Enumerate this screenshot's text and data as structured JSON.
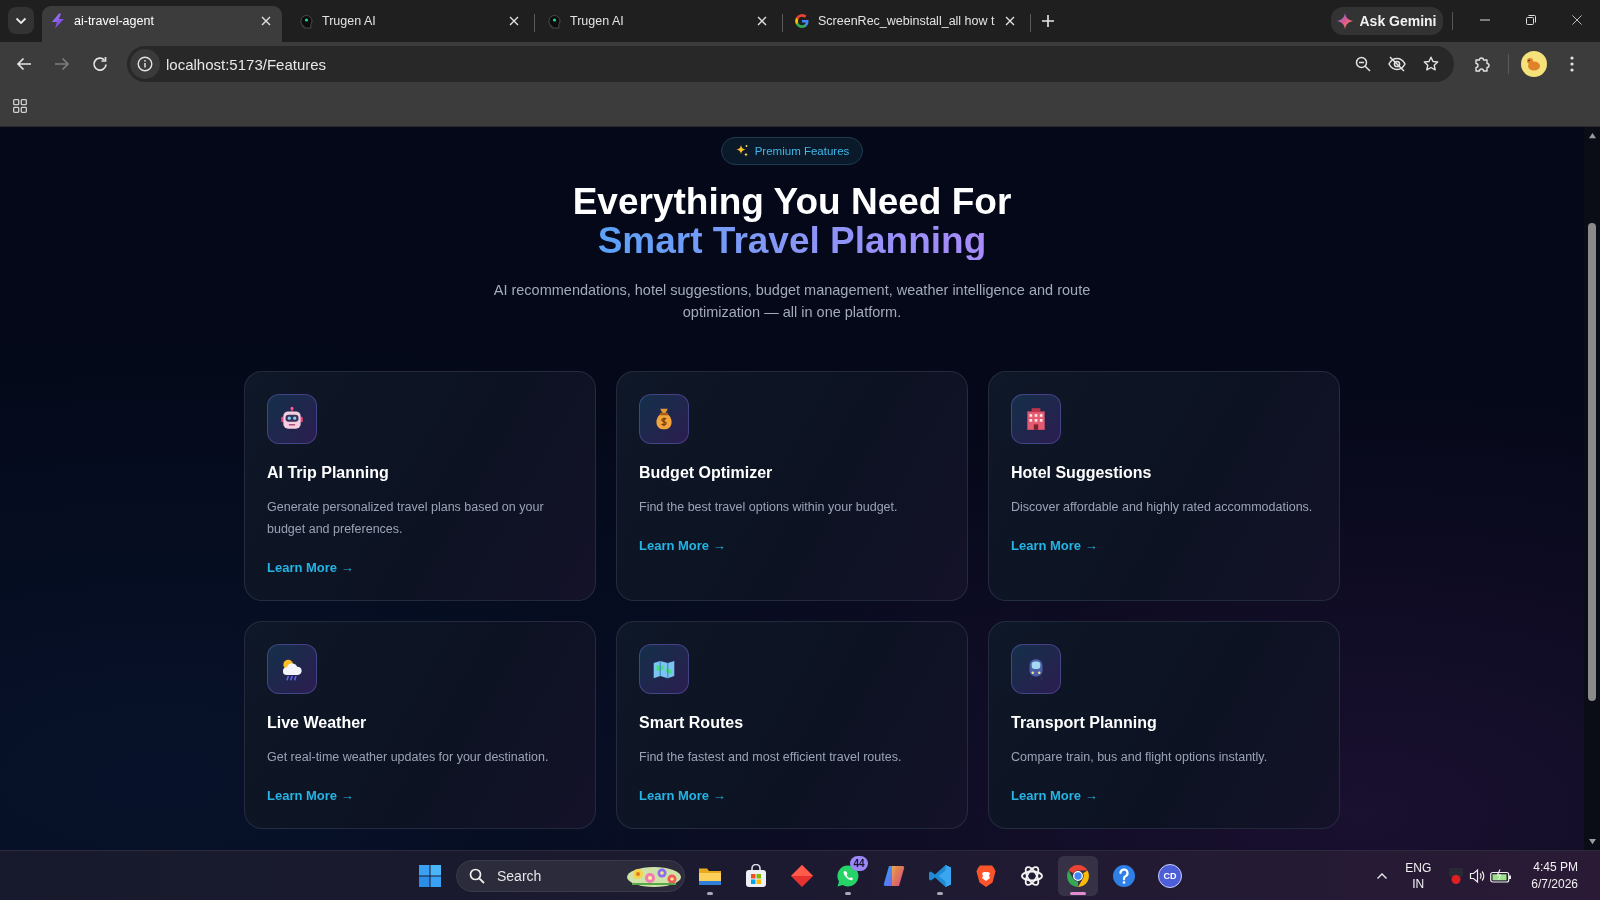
{
  "tabs": [
    {
      "kind": "bolt",
      "title": "ai-travel-agent",
      "selected": true
    },
    {
      "kind": "head",
      "title": "Trugen AI",
      "selected": false
    },
    {
      "kind": "head",
      "title": "Trugen AI",
      "selected": false
    },
    {
      "kind": "g-logo",
      "title": "ScreenRec_webinstall_all how t",
      "selected": false
    }
  ],
  "gemini_button": "Ask Gemini",
  "nav_buttons": [
    {
      "kind": "back",
      "disabled": false
    },
    {
      "kind": "forward",
      "disabled": true
    },
    {
      "kind": "reload",
      "disabled": false
    }
  ],
  "address": "localhost:5173/Features",
  "page": {
    "badge": "Premium Features",
    "heading": "Everything You Need For",
    "heading_highlight": "Smart Travel Planning",
    "subtitle": "AI recommendations, hotel suggestions, budget management, weather intelligence and route optimization — all in one platform.",
    "cards": [
      {
        "kind": "robot",
        "title": "AI Trip Planning",
        "description": "Generate personalized travel plans based on your budget and preferences.",
        "link": "Learn More →"
      },
      {
        "kind": "money-bag",
        "title": "Budget Optimizer",
        "description": "Find the best travel options within your budget.",
        "link": "Learn More →"
      },
      {
        "kind": "hotel",
        "title": "Hotel Suggestions",
        "description": "Discover affordable and highly rated accommodations.",
        "link": "Learn More →"
      },
      {
        "kind": "weather",
        "title": "Live Weather",
        "description": "Get real-time weather updates for your destination.",
        "link": "Learn More →"
      },
      {
        "kind": "map",
        "title": "Smart Routes",
        "description": "Find the fastest and most efficient travel routes.",
        "link": "Learn More →"
      },
      {
        "kind": "tram",
        "title": "Transport Planning",
        "description": "Compare train, bus and flight options instantly.",
        "link": "Learn More →"
      }
    ]
  },
  "taskbar": {
    "search": {
      "placeholder": "Search"
    },
    "apps": [
      {
        "kind": "folder",
        "running": true,
        "active": false
      },
      {
        "kind": "store",
        "running": false,
        "active": false
      },
      {
        "kind": "diamond",
        "running": false,
        "active": false
      },
      {
        "kind": "chat",
        "badge": "44",
        "running": true,
        "active": false
      },
      {
        "kind": "copilot",
        "running": false,
        "active": false
      },
      {
        "kind": "code",
        "running": true,
        "active": false
      },
      {
        "kind": "shield",
        "running": false,
        "active": false
      },
      {
        "kind": "knot",
        "running": false,
        "active": false
      },
      {
        "kind": "chrome",
        "running": true,
        "active": true
      },
      {
        "kind": "help",
        "running": false,
        "active": false
      },
      {
        "kind": "cd",
        "label": "CD",
        "running": false,
        "active": false
      }
    ],
    "tray": {
      "language": "ENG",
      "region": "IN",
      "time": "4:45 PM",
      "date": "6/7/2026"
    }
  }
}
